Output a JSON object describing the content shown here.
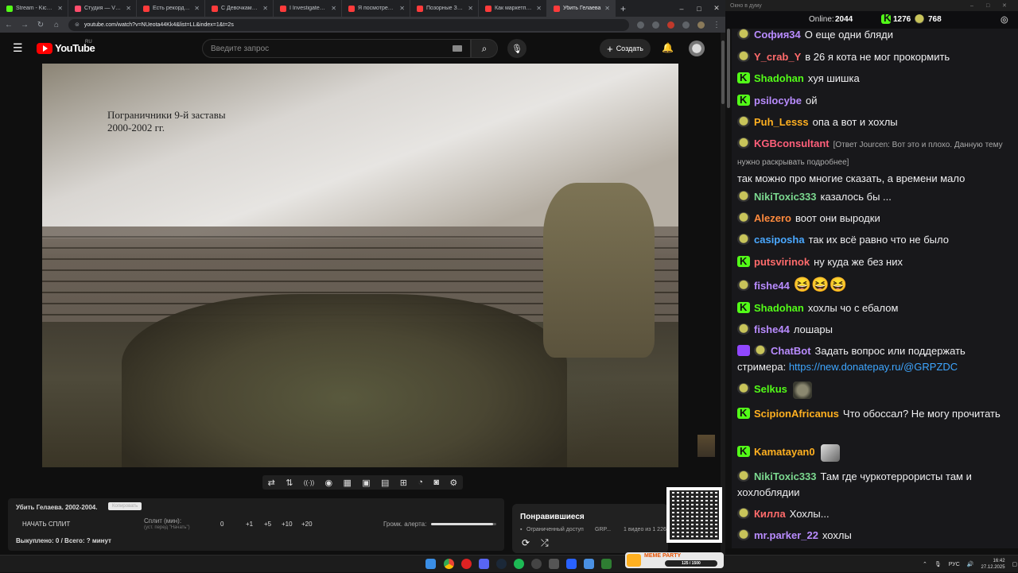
{
  "browser": {
    "tabs": [
      {
        "title": "Stream - Kick Dash",
        "color": "#53fc18",
        "active": false
      },
      {
        "title": "Студия — VK Видео",
        "color": "#ff4d6d",
        "active": false
      },
      {
        "title": "Есть рекорд! Перв",
        "color": "#ff3b3b",
        "active": false
      },
      {
        "title": "С Девочками Бол",
        "color": "#ff3b3b",
        "active": false
      },
      {
        "title": "I Investigated Mini",
        "color": "#ff3b3b",
        "active": false
      },
      {
        "title": "Я посмотрел все с",
        "color": "#ff3b3b",
        "active": false
      },
      {
        "title": "Позорные Зоозащ",
        "color": "#ff3b3b",
        "active": false
      },
      {
        "title": "Как маркетплейсы",
        "color": "#ff3b3b",
        "active": false
      },
      {
        "title": "Убить Гелаева",
        "color": "#ff3b3b",
        "active": true
      }
    ],
    "new_tab": "+",
    "url": "youtube.com/watch?v=NUeota44Kk4&list=LL&index=1&t=2s",
    "back": "←",
    "forward": "→",
    "reload": "↻",
    "home": "⌂",
    "window_controls": [
      "–",
      "□",
      "✕"
    ]
  },
  "youtube": {
    "logo_text": "YouTube",
    "region": "RU",
    "search_placeholder": "Введите запрос",
    "search_icon": "⌕",
    "mic_icon": "🎙",
    "create_label": "Создать",
    "create_icon": "+",
    "bell_icon": "🔔",
    "menu_icon": "☰"
  },
  "video": {
    "caption_line1": "Пограничники 9-й заставы",
    "caption_line2": "2000-2002 гг.",
    "control_icons": [
      "⇄",
      "⇅",
      "((·))",
      "◉",
      "▦",
      "▣",
      "▤",
      "⊞",
      "◔",
      "◙",
      "⚙"
    ]
  },
  "split": {
    "title": "Убить Гелаева. 2002-2004.",
    "copy_label": "Копировать",
    "start_label": "НАЧАТЬ СПЛИТ",
    "split_label": "Сплит (мин):",
    "split_hint": "(уст. перед \"Начать\")",
    "zero": "0",
    "steps": [
      "+1",
      "+5",
      "+10",
      "+20"
    ],
    "alert_label": "Громк. алерта:",
    "alert_level": 0.95,
    "bought": "Выкуплено: 0 / Всего: ? минут"
  },
  "liked": {
    "title": "Понравившиеся",
    "access": "Ограниченный доступ",
    "author": "GRP...",
    "meta": "1 видео из 1 226",
    "loop_icon": "⟳",
    "shuffle_icon": "⤮"
  },
  "chat": {
    "window_title": "Окно в думу",
    "online_label": "Online:",
    "online_count": "2044",
    "kick_count": "1276",
    "other_count": "768",
    "messages": [
      {
        "badge": "p",
        "nick": "София34",
        "color": "#b98cff",
        "text": "О еще одни бляди"
      },
      {
        "badge": "p",
        "nick": "Y_crab_Y",
        "color": "#ff6b6b",
        "text": "в 26 я кота не мог прокормить"
      },
      {
        "badge": "k",
        "nick": "Shadohan",
        "color": "#53fc18",
        "text": "хуя шишка"
      },
      {
        "badge": "k",
        "nick": "psilocybe",
        "color": "#b98cff",
        "text": "ой"
      },
      {
        "badge": "p",
        "nick": "Puh_Lesss",
        "color": "#ffb020",
        "text": "опа а вот и хохлы"
      },
      {
        "badge": "p",
        "nick": "KGBconsultant",
        "color": "#ff5f7a",
        "reply": "[Ответ Jourcen: Вот это и плохо. Данную тему нужно раскрывать подробнее]",
        "text": "так можно про многие сказать, а времени мало"
      },
      {
        "badge": "p",
        "nick": "NikiToxic333",
        "color": "#7bd88f",
        "text": "казалось бы ..."
      },
      {
        "badge": "p",
        "nick": "Alezero",
        "color": "#ff8a3d",
        "text": "воот они выродки"
      },
      {
        "badge": "p",
        "nick": "casiposha",
        "color": "#4aa8ff",
        "text": "так их всё равно что не было"
      },
      {
        "badge": "k",
        "nick": "putsvirinok",
        "color": "#ff6b6b",
        "text": "ну куда же без них"
      },
      {
        "badge": "p",
        "nick": "fishe44",
        "color": "#b98cff",
        "text": "😆😆😆"
      },
      {
        "badge": "k",
        "nick": "Shadohan",
        "color": "#53fc18",
        "text": "хохлы чо с ебалом"
      },
      {
        "badge": "p",
        "nick": "fishe44",
        "color": "#b98cff",
        "text": "лошары"
      },
      {
        "badge": "bot",
        "nick": "ChatBot",
        "color": "#b98cff",
        "text": "Задать вопрос или поддержать стримера:",
        "link": "https://new.donatepay.ru/@GRPZDC"
      },
      {
        "badge": "p",
        "nick": "Selkus",
        "color": "#53fc18",
        "text": ""
      },
      {
        "badge": "k",
        "nick": "ScipionAfricanus",
        "color": "#ffb020",
        "text": "Что обоссал? Не могу прочитать"
      },
      {
        "badge": "k",
        "nick": "Kamatayan0",
        "color": "#ffb020",
        "text": ""
      },
      {
        "badge": "p",
        "nick": "NikiToxic333",
        "color": "#7bd88f",
        "text": "Там где чуркотеррористы там и хохлоблядии"
      },
      {
        "badge": "p",
        "nick": "Килла",
        "color": "#ff6b6b",
        "text": "Хохлы..."
      },
      {
        "badge": "p",
        "nick": "mr.parker_22",
        "color": "#b98cff",
        "text": "хохлы"
      }
    ]
  },
  "taskbar": {
    "meme_label": "MEME PARTY",
    "meme_count": "125 / 1500",
    "lang": "РУС",
    "time": "16:42",
    "date": "27.12.2025"
  }
}
